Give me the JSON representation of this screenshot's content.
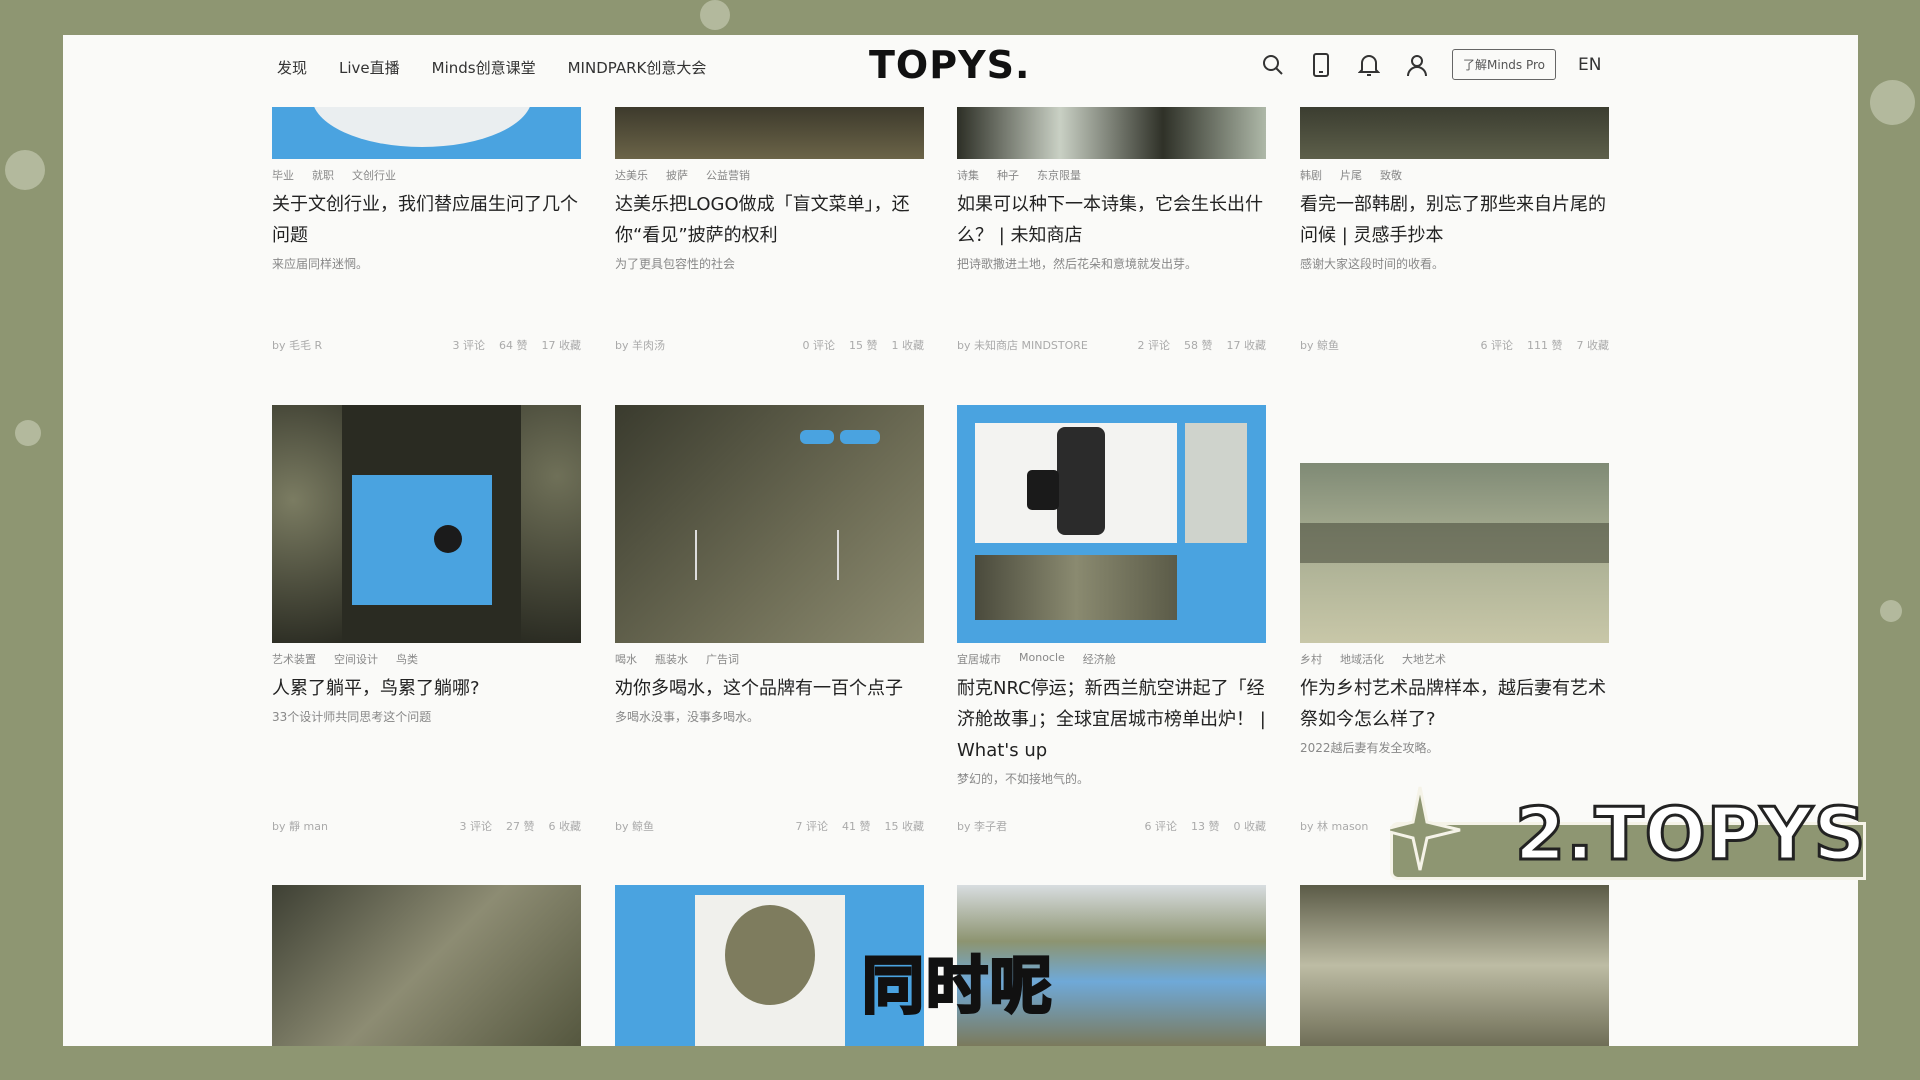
{
  "header": {
    "nav": [
      "发现",
      "Live直播",
      "Minds创意课堂",
      "MINDPARK创意大会"
    ],
    "logo": "TOPYS.",
    "pro_button": "了解Minds Pro",
    "lang": "EN",
    "icons": [
      "search-icon",
      "mobile-icon",
      "bell-icon",
      "user-icon"
    ]
  },
  "row1": [
    {
      "tags": [
        "毕业",
        "就职",
        "文创行业"
      ],
      "title": "关于文创行业，我们替应届生问了几个问题",
      "sub": "来应届同样迷惘。",
      "author": "by 毛毛 R",
      "comments": "3 评论",
      "likes": "64 赞",
      "saves": "17 收藏"
    },
    {
      "tags": [
        "达美乐",
        "披萨",
        "公益营销"
      ],
      "title": "达美乐把LOGO做成「盲文菜单」，还你“看见”披萨的权利",
      "sub": "为了更具包容性的社会",
      "author": "by 羊肉汤",
      "comments": "0 评论",
      "likes": "15 赞",
      "saves": "1 收藏"
    },
    {
      "tags": [
        "诗集",
        "种子",
        "东京限量"
      ],
      "title": "如果可以种下一本诗集，它会生长出什么？ | 未知商店",
      "sub": "把诗歌撒进土地，然后花朵和意境就发出芽。",
      "author": "by 未知商店 MINDSTORE",
      "comments": "2 评论",
      "likes": "58 赞",
      "saves": "17 收藏"
    },
    {
      "tags": [
        "韩剧",
        "片尾",
        "致敬"
      ],
      "title": "看完一部韩剧，别忘了那些来自片尾的问候 | 灵感手抄本",
      "sub": "感谢大家这段时间的收看。",
      "author": "by 鲸鱼",
      "comments": "6 评论",
      "likes": "111 赞",
      "saves": "7 收藏"
    }
  ],
  "row2": [
    {
      "tags": [
        "艺术装置",
        "空间设计",
        "鸟类"
      ],
      "title": "人累了躺平，鸟累了躺哪?",
      "sub": "33个设计师共同思考这个问题",
      "author": "by 靜 man",
      "comments": "3 评论",
      "likes": "27 赞",
      "saves": "6 收藏"
    },
    {
      "tags": [
        "喝水",
        "瓶装水",
        "广告词"
      ],
      "title": "劝你多喝水，这个品牌有一百个点子",
      "sub": "多喝水没事，没事多喝水。",
      "author": "by 鲸鱼",
      "comments": "7 评论",
      "likes": "41 赞",
      "saves": "15 收藏"
    },
    {
      "tags": [
        "宜居城市",
        "Monocle",
        "经济舱"
      ],
      "title": "耐克NRC停运；新西兰航空讲起了「经济舱故事」；全球宜居城市榜单出炉！ | What's up",
      "sub": "梦幻的，不如接地气的。",
      "author": "by 李子君",
      "comments": "6 评论",
      "likes": "13 赞",
      "saves": "0 收藏"
    },
    {
      "tags": [
        "乡村",
        "地域活化",
        "大地艺术"
      ],
      "title": "作为乡村艺术品牌样本，越后妻有艺术祭如今怎么样了?",
      "sub": "2022越后妻有发全攻略。",
      "author": "by 林 mason",
      "comments": "",
      "likes": "",
      "saves": ""
    }
  ],
  "overlay": {
    "banner": "2.TOPYS",
    "subtitle": "同时呢"
  },
  "colors": {
    "accent": "#4aa3e0",
    "frame_bg": "#8e9672",
    "page_bg": "#fafaf8"
  }
}
